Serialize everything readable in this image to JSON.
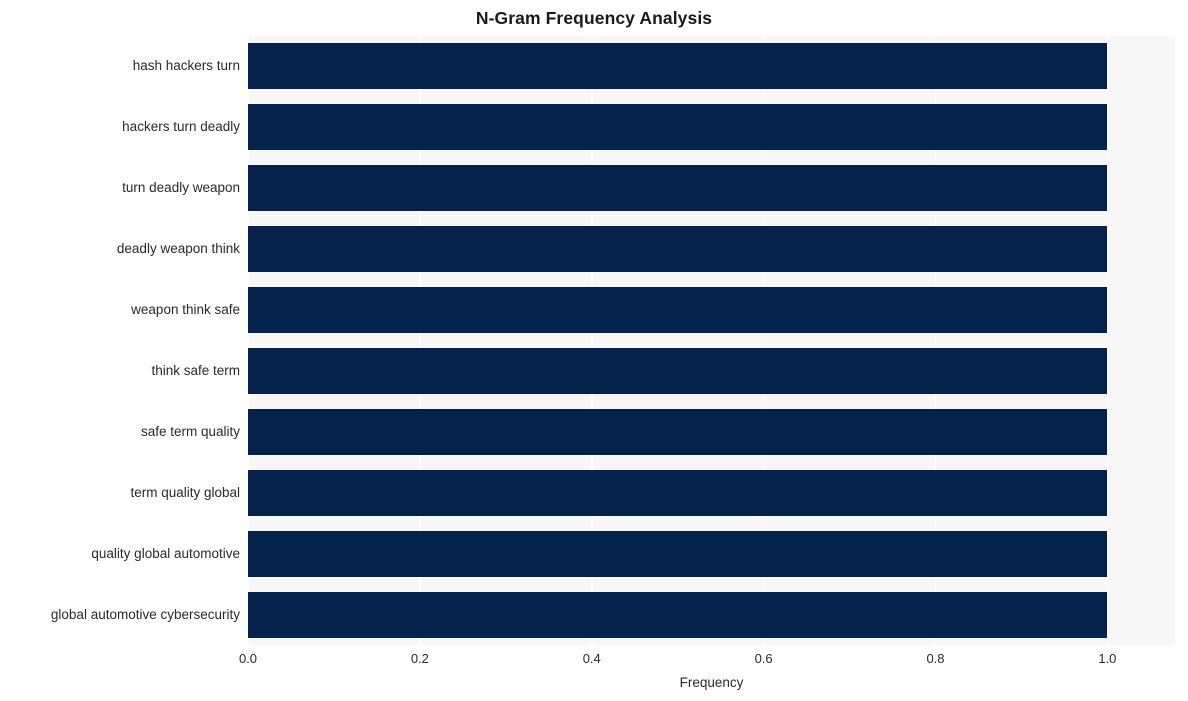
{
  "chart_data": {
    "type": "bar",
    "orientation": "horizontal",
    "title": "N-Gram Frequency Analysis",
    "xlabel": "Frequency",
    "ylabel": "",
    "categories": [
      "hash hackers turn",
      "hackers turn deadly",
      "turn deadly weapon",
      "deadly weapon think",
      "weapon think safe",
      "think safe term",
      "safe term quality",
      "term quality global",
      "quality global automotive",
      "global automotive cybersecurity"
    ],
    "values": [
      1.0,
      1.0,
      1.0,
      1.0,
      1.0,
      1.0,
      1.0,
      1.0,
      1.0,
      1.0
    ],
    "xlim": [
      0.0,
      1.0787
    ],
    "xticks": [
      0.0,
      0.2,
      0.4,
      0.6,
      0.8,
      1.0
    ],
    "xtick_labels": [
      "0.0",
      "0.2",
      "0.4",
      "0.6",
      "0.8",
      "1.0"
    ],
    "grid": true,
    "grid_axis": "x",
    "legend": null,
    "colors": {
      "bar": "#04224c",
      "plot_background": "#f7f7f7",
      "figure_background": "#ffffff",
      "gridline": "#ffffff",
      "text": "#2a2a2a",
      "title_text": "#1a1a1a"
    }
  }
}
